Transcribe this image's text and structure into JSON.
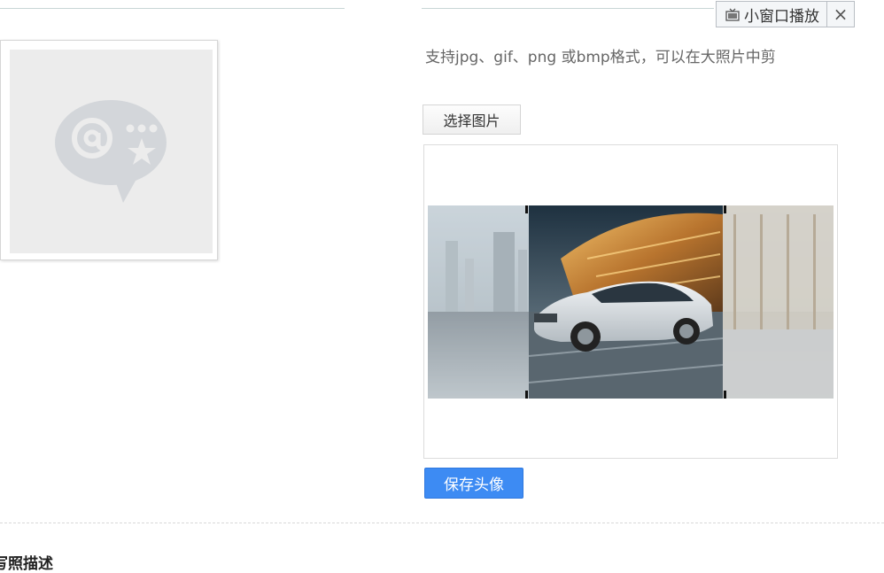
{
  "mini_window": {
    "label": "小窗口播放",
    "close_label": "×"
  },
  "avatar": {
    "placeholder_icon": "at-star-chat-bubble-icon"
  },
  "upload": {
    "hint": "支持jpg、gif、png 或bmp格式，可以在大照片中剪",
    "choose_label": "选择图片",
    "save_label": "保存头像"
  },
  "section": {
    "title": "写照描述"
  },
  "colors": {
    "accent": "#3d8bf3",
    "placeholder_bg": "#ececec"
  }
}
